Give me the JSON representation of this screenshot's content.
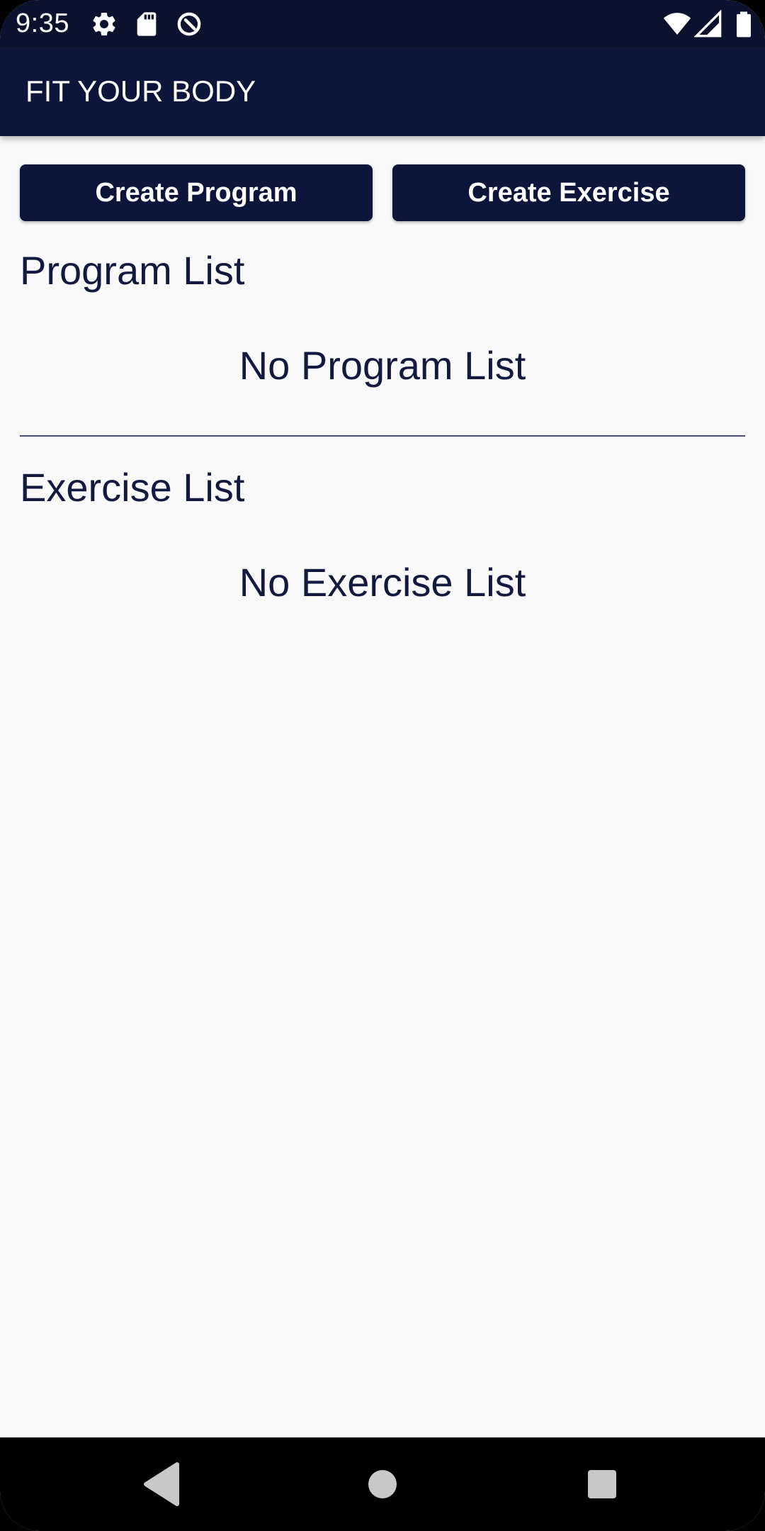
{
  "status_bar": {
    "time": "9:35",
    "icons_left": [
      "settings-icon",
      "sd-card-icon",
      "data-saver-icon"
    ],
    "icons_right": [
      "wifi-icon",
      "cell-signal-icon",
      "battery-icon"
    ]
  },
  "app_bar": {
    "title": "FIT YOUR BODY"
  },
  "buttons": {
    "create_program": "Create Program",
    "create_exercise": "Create Exercise"
  },
  "program_section": {
    "title": "Program List",
    "empty_message": "No Program List"
  },
  "exercise_section": {
    "title": "Exercise List",
    "empty_message": "No Exercise List"
  },
  "nav_bar": {
    "icons": [
      "back-icon",
      "home-icon",
      "recents-icon"
    ]
  },
  "colors": {
    "primary": "#0e153a",
    "status_bar": "#0c122e",
    "background": "#f9f9f9",
    "text": "#141a3f"
  }
}
